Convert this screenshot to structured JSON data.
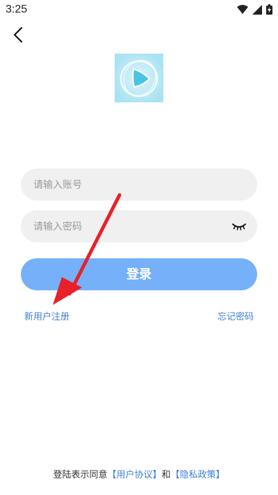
{
  "status_bar": {
    "time": "3:25",
    "icons": [
      "wifi-icon",
      "signal-icon",
      "battery-icon"
    ]
  },
  "nav": {
    "back_icon": "chevron-left-icon"
  },
  "logo": {
    "icon": "app-logo-play-icon"
  },
  "form": {
    "account_placeholder": "请输入账号",
    "account_value": "",
    "password_placeholder": "请输入密码",
    "password_value": "",
    "password_toggle_icon": "eye-closed-icon",
    "login_label": "登录"
  },
  "links": {
    "register": "新用户注册",
    "forgot_password": "忘记密码"
  },
  "agreement": {
    "prefix": "登陆表示同意",
    "user_agreement": "【用户协议】",
    "and": "和",
    "privacy_policy": "【隐私政策】"
  },
  "colors": {
    "accent": "#75b0f8",
    "link": "#3d7fd6",
    "input_bg": "#f0f0f0",
    "annotation_arrow": "#e8202a"
  }
}
